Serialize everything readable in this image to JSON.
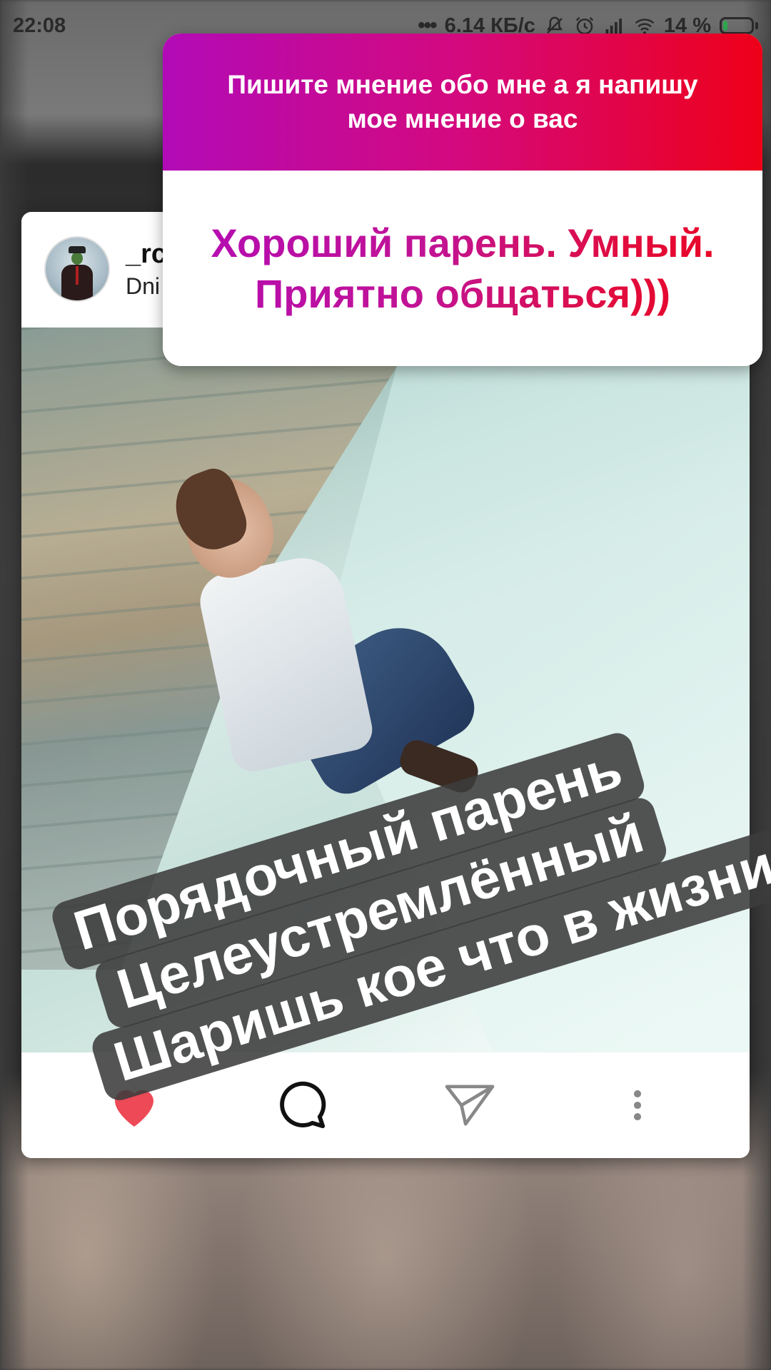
{
  "status_bar": {
    "time": "22:08",
    "network_speed": "6.14 КБ/с",
    "battery_percent": "14 %",
    "battery_level": 0.14,
    "icons": [
      "more-dots-icon",
      "mute-icon",
      "alarm-icon",
      "signal-icon",
      "wifi-icon",
      "battery-icon"
    ]
  },
  "question_sticker": {
    "question": "Пишите мнение обо мне а я напишу мое мнение о вас",
    "answer": "Хороший парень. Умный. Приятно общаться)))",
    "gradient_start": "#b20bb7",
    "gradient_end": "#ee0018"
  },
  "post": {
    "username": "_rc",
    "subtitle": "Dni",
    "caption_lines": [
      "Порядочный парень",
      "Целеустремлённый",
      "Шаришь кое что в жизни"
    ],
    "actions": {
      "like_icon": "heart-icon",
      "like_color": "#ed4956",
      "comment_icon": "comment-icon",
      "share_icon": "send-icon",
      "more_icon": "more-vertical-icon"
    }
  }
}
